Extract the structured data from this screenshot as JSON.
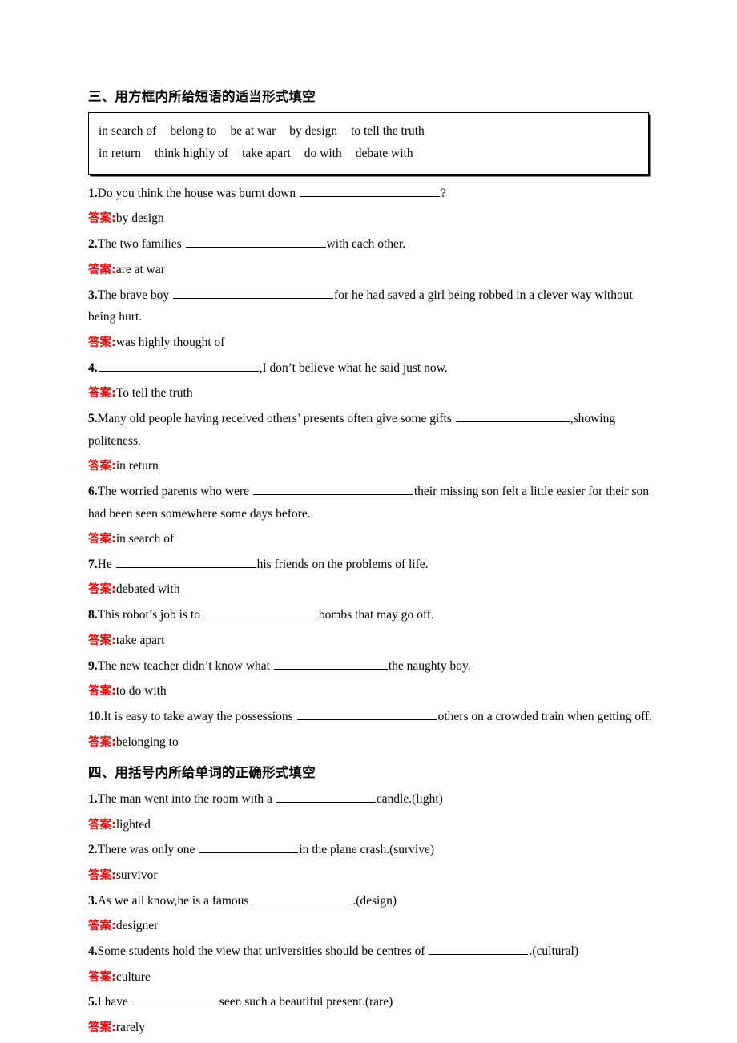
{
  "document": {
    "language": "zh-CN",
    "page_background": "#ffffff",
    "answer_label_color": "#FF0000",
    "body_text_color": "#000000"
  },
  "sections": [
    {
      "id": "section-three",
      "heading": "三、用方框内所给短语的适当形式填空",
      "word_bank": {
        "rows": [
          [
            "in search of",
            "belong to",
            "be at war",
            "by design",
            "to tell the truth"
          ],
          [
            "in return",
            "think highly of",
            "take apart",
            "do with",
            "debate with"
          ]
        ]
      },
      "answer_label": "答案:",
      "items": [
        {
          "number": "1.",
          "parts": [
            {
              "type": "text",
              "value": "Do you think the house was burnt down "
            },
            {
              "type": "blank",
              "size": "b-xl"
            },
            {
              "type": "text",
              "value": "?"
            }
          ],
          "plain": "1.Do you think the house was burnt down ________?",
          "answer": "by design"
        },
        {
          "number": "2.",
          "parts": [
            {
              "type": "text",
              "value": "The two families "
            },
            {
              "type": "blank",
              "size": "b-xl"
            },
            {
              "type": "text",
              "value": "with each other."
            }
          ],
          "plain": "2.The two families ________with each other.",
          "answer": "are at war"
        },
        {
          "number": "3.",
          "parts": [
            {
              "type": "text",
              "value": "The brave boy "
            },
            {
              "type": "blank",
              "size": "b-xxl"
            },
            {
              "type": "text",
              "value": "for he had saved a girl being robbed in a clever way without being hurt."
            }
          ],
          "plain": "3.The brave boy ________for he had saved a girl being robbed in a clever way without being hurt.",
          "answer": "was highly thought of"
        },
        {
          "number": "4.",
          "parts": [
            {
              "type": "blank",
              "size": "b-xxl"
            },
            {
              "type": "text",
              "value": ",I don’t believe what he said just now."
            }
          ],
          "plain": "4.________,I don’t believe what he said just now.",
          "answer": "To tell the truth"
        },
        {
          "number": "5.",
          "parts": [
            {
              "type": "text",
              "value": "Many old people having received others’ presents often give some gifts "
            },
            {
              "type": "blank",
              "size": "b-lg"
            },
            {
              "type": "text",
              "value": ",showing politeness."
            }
          ],
          "plain": "5.Many old people having received others’ presents often give some gifts ________,showing politeness.",
          "answer": "in return"
        },
        {
          "number": "6.",
          "parts": [
            {
              "type": "text",
              "value": "The worried parents who were "
            },
            {
              "type": "blank",
              "size": "b-xxl"
            },
            {
              "type": "text",
              "value": "their missing son felt a little easier for their son had been seen somewhere some days before."
            }
          ],
          "plain": "6.The worried parents who were ________their missing son felt a little easier for their son had been seen somewhere some days before.",
          "answer": "in search of"
        },
        {
          "number": "7.",
          "parts": [
            {
              "type": "text",
              "value": "He "
            },
            {
              "type": "blank",
              "size": "b-xl"
            },
            {
              "type": "text",
              "value": "his friends on the problems of life."
            }
          ],
          "plain": "7.He ________his friends on the problems of life.",
          "answer": "debated with"
        },
        {
          "number": "8.",
          "parts": [
            {
              "type": "text",
              "value": "This robot’s job is to "
            },
            {
              "type": "blank",
              "size": "b-lg"
            },
            {
              "type": "text",
              "value": "bombs that may go off."
            }
          ],
          "plain": "8.This robot’s job is to ________bombs that may go off.",
          "answer": "take apart"
        },
        {
          "number": "9.",
          "parts": [
            {
              "type": "text",
              "value": "The new teacher didn’t know what "
            },
            {
              "type": "blank",
              "size": "b-lg"
            },
            {
              "type": "text",
              "value": "the naughty boy."
            }
          ],
          "plain": "9.The new teacher didn’t know what ________the naughty boy.",
          "answer": "to do with"
        },
        {
          "number": "10.",
          "parts": [
            {
              "type": "text",
              "value": "It is easy to take away the possessions "
            },
            {
              "type": "blank",
              "size": "b-xl"
            },
            {
              "type": "text",
              "value": "others on a crowded train when getting off."
            }
          ],
          "plain": "10.It is easy to take away the possessions ________others on a crowded train when getting off.",
          "answer": "belonging to"
        }
      ]
    },
    {
      "id": "section-four",
      "heading": "四、用括号内所给单词的正确形式填空",
      "answer_label": "答案:",
      "items": [
        {
          "number": "1.",
          "parts": [
            {
              "type": "text",
              "value": "The man went into the room with a "
            },
            {
              "type": "blank",
              "size": "b-md"
            },
            {
              "type": "text",
              "value": "candle.(light)"
            }
          ],
          "plain": "1.The man went into the room with a ________candle.(light)",
          "answer": "lighted"
        },
        {
          "number": "2.",
          "parts": [
            {
              "type": "text",
              "value": "There was only one "
            },
            {
              "type": "blank",
              "size": "b-md"
            },
            {
              "type": "text",
              "value": "in the plane crash.(survive)"
            }
          ],
          "plain": "2.There was only one ________in the plane crash.(survive)",
          "answer": "survivor"
        },
        {
          "number": "3.",
          "parts": [
            {
              "type": "text",
              "value": "As we all know,he is a famous "
            },
            {
              "type": "blank",
              "size": "b-md"
            },
            {
              "type": "text",
              "value": ".(design)"
            }
          ],
          "plain": "3.As we all know,he is a famous ________.(design)",
          "answer": "designer"
        },
        {
          "number": "4.",
          "parts": [
            {
              "type": "text",
              "value": "Some students hold the view that universities should be centres of "
            },
            {
              "type": "blank",
              "size": "b-md"
            },
            {
              "type": "text",
              "value": ".(cultural)"
            }
          ],
          "plain": "4.Some students hold the view that universities should be centres of ________.(cultural)",
          "answer": "culture"
        },
        {
          "number": "5.",
          "parts": [
            {
              "type": "text",
              "value": "I have "
            },
            {
              "type": "blank",
              "size": "b-sm"
            },
            {
              "type": "text",
              "value": "seen such a beautiful present.(rare)"
            }
          ],
          "plain": "5.I have ________seen such a beautiful present.(rare)",
          "answer": "rarely"
        }
      ]
    }
  ]
}
